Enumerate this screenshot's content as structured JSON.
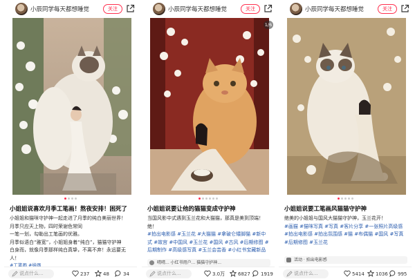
{
  "panels": [
    {
      "username": "小辰同学每天都想睡觉",
      "follow_label": "关注",
      "title": "小姐姐说喜欢月季工笔画！熬夜安排！困死了",
      "body_lines": [
        "小姐姐和猫咪守护神一起走进了月季的纯白美丽世界！",
        "月季只应天上物，四时荣谢色常同",
        "一笔一划，勾勒出工笔画的优雅。",
        "月季似语白“雅宽”，小姐姐身着“纯白”，猫猫守护神",
        "白身而，就像月季那样纯白真挚，不离不弃！永远要无",
        "人！"
      ],
      "tags_line": "#工笔画 #绘画",
      "comment_placeholder": "说点什么...",
      "likes": "237",
      "favorites": "48",
      "comments": "34",
      "page_dots": 4,
      "active_dot": 0
    },
    {
      "username": "小辰同学每天都想睡觉",
      "follow_label": "关注",
      "page_badge": "1/6",
      "title": "小姐姐说要让他的猫猫变成守护神",
      "body_lines": [
        "当国风影中式遇到玉兰花和大猫猫，那真是美到顶端！",
        "绝！"
      ],
      "tags_text": "#拍出电影感 #玉兰花 #大猫猫 #拿破仑矮脚猫 #新中式 #故宫 #中国风 #玉兰花 #国风 #古风 #后期修图 #后期制作 #高级感写真 #玉兰会芸香 #小红书宝藏新品",
      "mention_text": "晴晴... 小红书用户... 猫猫守护神...",
      "comment_placeholder": "说点什么...",
      "likes": "3.0万",
      "favorites": "6827",
      "comments": "1919",
      "page_dots": 6,
      "active_dot": 0
    },
    {
      "username": "小辰同学每天都想睡觉",
      "follow_label": "关注",
      "title": "小姐姐说要工笔画风猫猫守护神",
      "body_lines": [
        "绝美的小姐姐与国风大猫猫守护神，玉兰花开！"
      ],
      "tags_text": "#画猫 #猫咪写真 #写真 #客片分享 #一张照片高级感 #拍出电影感 #拍出氛围感 #猫 #布偶猫 #国风 #写真 #后期修图 #玉兰花",
      "mention_text": "活动 · 拍出电影感",
      "comment_placeholder": "说点什么...",
      "likes": "5414",
      "favorites": "1036",
      "comments": "995",
      "page_dots": 5,
      "active_dot": 0
    }
  ],
  "colors": {
    "accent": "#ff2e4d",
    "tag": "#2a5cae"
  },
  "icons": [
    "avatar",
    "share-icon",
    "pen-icon",
    "heart-icon",
    "star-icon",
    "comment-icon"
  ]
}
